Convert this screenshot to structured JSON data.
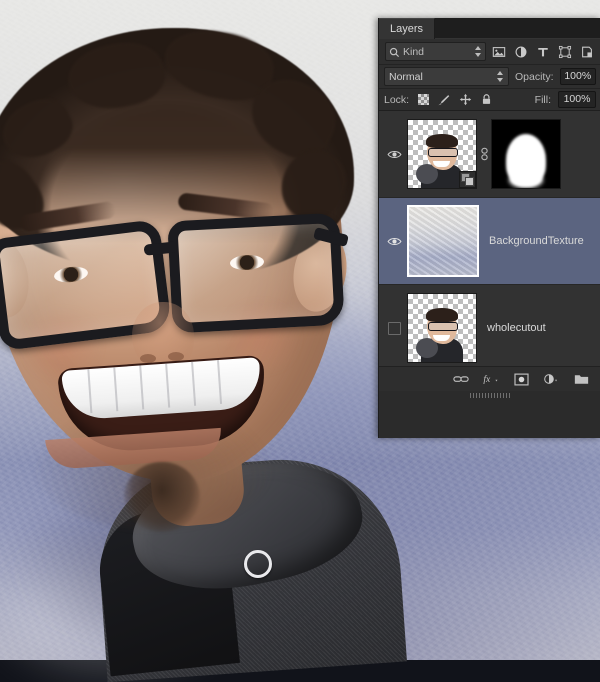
{
  "panel": {
    "tab_label": "Layers",
    "filter": {
      "kind_label": "Kind",
      "icons": [
        {
          "name": "filter-pixel-icon",
          "glyph": "image"
        },
        {
          "name": "filter-adjustment-icon",
          "glyph": "adjustment"
        },
        {
          "name": "filter-type-icon",
          "glyph": "T"
        },
        {
          "name": "filter-shape-icon",
          "glyph": "shape"
        },
        {
          "name": "filter-smart-object-icon",
          "glyph": "smart-object"
        }
      ]
    },
    "blend": {
      "mode": "Normal",
      "opacity_label": "Opacity:",
      "opacity_value": "100%"
    },
    "lock": {
      "label": "Lock:",
      "fill_label": "Fill:",
      "fill_value": "100%",
      "icons": [
        {
          "name": "lock-transparent-pixels-icon"
        },
        {
          "name": "lock-image-pixels-icon"
        },
        {
          "name": "lock-position-icon"
        },
        {
          "name": "lock-all-icon"
        }
      ]
    },
    "layers": [
      {
        "name": "",
        "visible": true,
        "selected": false,
        "has_mask": true,
        "thumb_kind": "person-cutout",
        "mask_kind": "silhouette",
        "linked": true,
        "has_fx_badge": true
      },
      {
        "name": "BackgroundTexture",
        "visible": true,
        "selected": true,
        "has_mask": false,
        "thumb_kind": "texture",
        "linked": false,
        "has_fx_badge": false
      },
      {
        "name": "wholecutout",
        "visible": false,
        "selected": false,
        "has_mask": false,
        "thumb_kind": "person-cutout",
        "linked": false,
        "has_fx_badge": false
      },
      {
        "name": "",
        "visible": false,
        "selected": false,
        "has_mask": false,
        "thumb_kind": "partial",
        "linked": false,
        "has_fx_badge": false
      }
    ],
    "footer_icons": [
      {
        "name": "link-layers-icon"
      },
      {
        "name": "add-layer-style-fx-icon",
        "label": "fx"
      },
      {
        "name": "add-layer-mask-icon"
      },
      {
        "name": "new-fill-adjustment-layer-icon"
      },
      {
        "name": "new-group-folder-icon"
      }
    ]
  },
  "colors": {
    "panel_bg": "#2b2b2b",
    "row_bg": "#323232",
    "selected_row": "#5b6480",
    "text": "#d9d9d9",
    "tab_bg": "#343434"
  },
  "canvas": {
    "description": "portrait-photo-caricature"
  }
}
